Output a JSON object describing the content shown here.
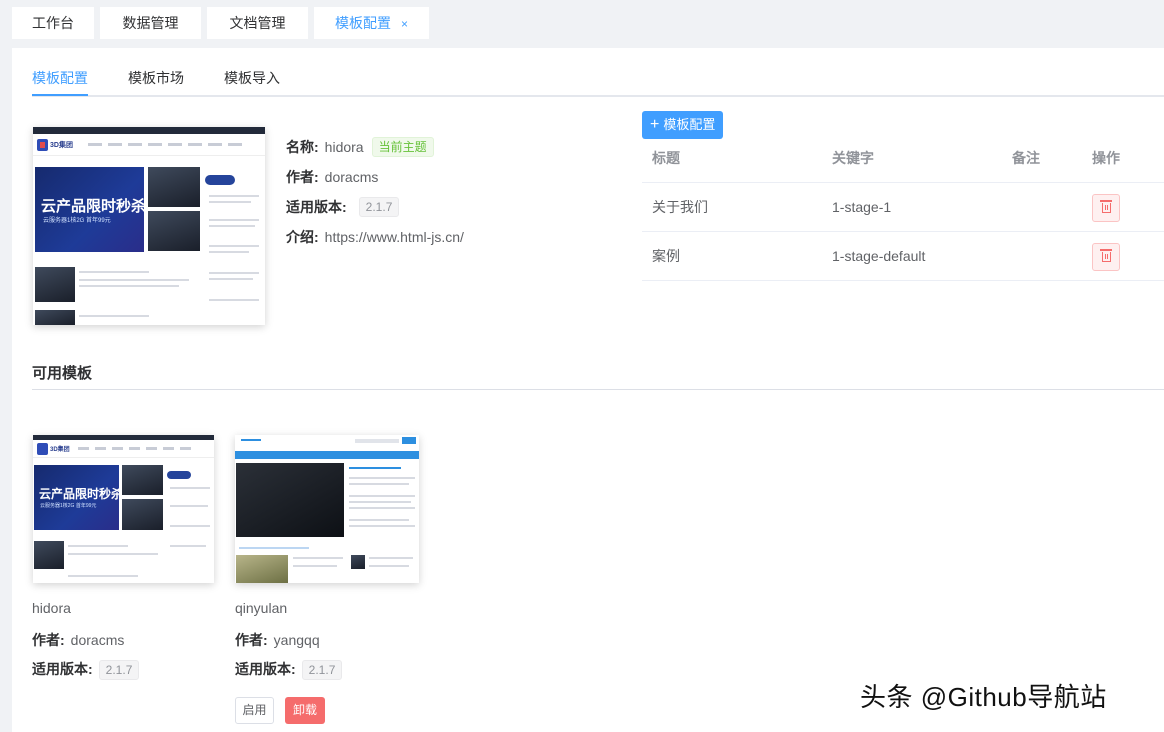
{
  "top_tabs": [
    {
      "label": "工作台"
    },
    {
      "label": "数据管理"
    },
    {
      "label": "文档管理"
    },
    {
      "label": "模板配置",
      "close": "×"
    }
  ],
  "sub_tabs": [
    {
      "label": "模板配置"
    },
    {
      "label": "模板市场"
    },
    {
      "label": "模板导入"
    }
  ],
  "current": {
    "name_label": "名称:",
    "name": "hidora",
    "current_tag": "当前主题",
    "author_label": "作者:",
    "author": "doracms",
    "version_label": "适用版本:",
    "version": "2.1.7",
    "intro_label": "介绍:",
    "intro": "https://www.html-js.cn/",
    "thumb_banner": "云产品限时秒杀",
    "thumb_banner_sub": "云服务器1核2G 首年99元",
    "thumb_logo": "3D集团"
  },
  "config": {
    "add_label": "模板配置",
    "columns": [
      "标题",
      "关键字",
      "备注",
      "操作"
    ],
    "rows": [
      {
        "title": "关于我们",
        "keyword": "1-stage-1",
        "note": ""
      },
      {
        "title": "案例",
        "keyword": "1-stage-default",
        "note": ""
      }
    ]
  },
  "available": {
    "title": "可用模板",
    "cards": [
      {
        "name": "hidora",
        "author_label": "作者:",
        "author": "doracms",
        "version_label": "适用版本:",
        "version": "2.1.7",
        "banner": "云产品限时秒杀",
        "banner_sub": "云服务器1核2G 首年99元",
        "logo": "3D集团"
      },
      {
        "name": "qinyulan",
        "author_label": "作者:",
        "author": "yangqq",
        "version_label": "适用版本:",
        "version": "2.1.7",
        "enable_label": "启用",
        "uninstall_label": "卸载"
      }
    ]
  },
  "watermark": "头条 @Github导航站",
  "colors": {
    "accent": "#409eff",
    "danger": "#f56c6c",
    "success": "#67c23a"
  }
}
